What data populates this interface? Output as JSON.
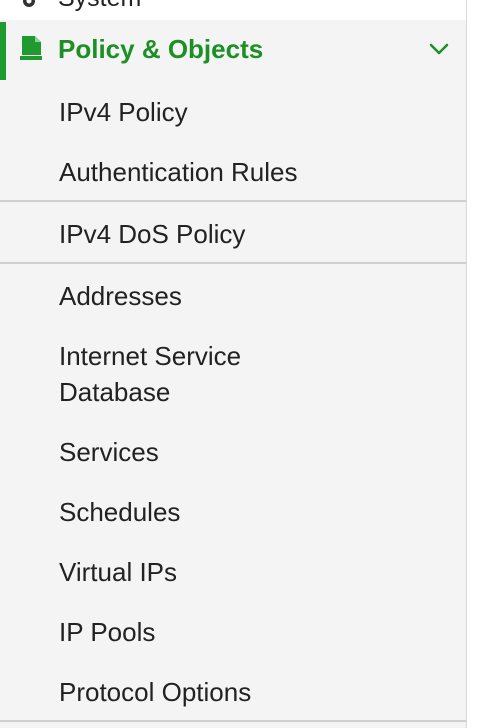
{
  "top_item": {
    "label": "System",
    "icon": "gear-icon"
  },
  "section": {
    "label": "Policy & Objects",
    "icon": "policy-document-icon",
    "accent_color": "#1f9a2f",
    "text_color": "#1c8f25",
    "expanded": true
  },
  "items": [
    {
      "label": "IPv4 Policy"
    },
    {
      "label": "Authentication Rules"
    },
    {
      "label": "IPv4 DoS Policy"
    },
    {
      "label": "Addresses"
    },
    {
      "label": "Internet Service"
    },
    {
      "label": "Database"
    },
    {
      "label": "Services"
    },
    {
      "label": "Schedules"
    },
    {
      "label": "Virtual IPs"
    },
    {
      "label": "IP Pools"
    },
    {
      "label": "Protocol Options"
    }
  ]
}
